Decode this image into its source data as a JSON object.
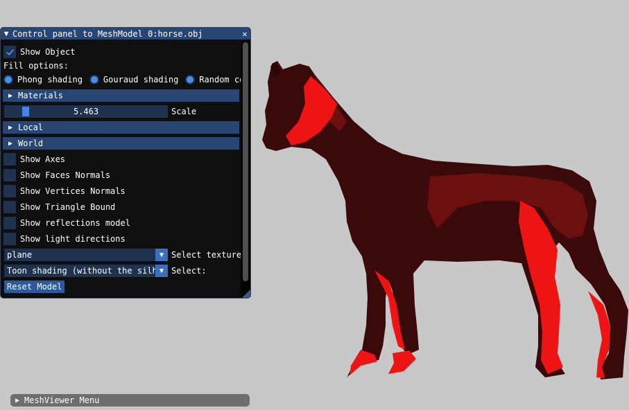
{
  "panel": {
    "title": "Control panel to MeshModel 0:horse.obj",
    "collapse_glyph": "▼",
    "close_glyph": "✕",
    "show_object": {
      "label": "Show Object",
      "checked": true
    },
    "fill_options_label": "Fill options:",
    "fill_options": [
      {
        "label": "Phong shading",
        "selected": true
      },
      {
        "label": "Gouraud shading",
        "selected": true
      },
      {
        "label": "Random co",
        "selected": true
      }
    ],
    "materials_header": "Materials",
    "scale": {
      "value": "5.463",
      "label": "Scale"
    },
    "local_header": "Local",
    "world_header": "World",
    "checkboxes": [
      {
        "label": "Show Axes",
        "checked": false
      },
      {
        "label": "Show Faces Normals",
        "checked": false
      },
      {
        "label": "Show Vertices Normals",
        "checked": false
      },
      {
        "label": "Show Triangle Bound",
        "checked": false
      },
      {
        "label": "Show reflections model",
        "checked": false
      },
      {
        "label": "Show light directions",
        "checked": false
      }
    ],
    "texture_combo": {
      "value": "plane",
      "label": "Select texture"
    },
    "shading_combo": {
      "value": "Toon shading (without the silho",
      "label": "Select:"
    },
    "reset_button": "Reset Model",
    "header_arrow": "▶",
    "combo_arrow": "▼"
  },
  "menubar": {
    "label": "MeshViewer Menu",
    "arrow": "▶"
  },
  "viewport": {
    "model": "horse",
    "colors": {
      "background": "#c8c8c8",
      "dark": "#3a0a0a",
      "mid": "#6b0f0f",
      "bright": "#ee1414",
      "accent": "#284674"
    }
  }
}
